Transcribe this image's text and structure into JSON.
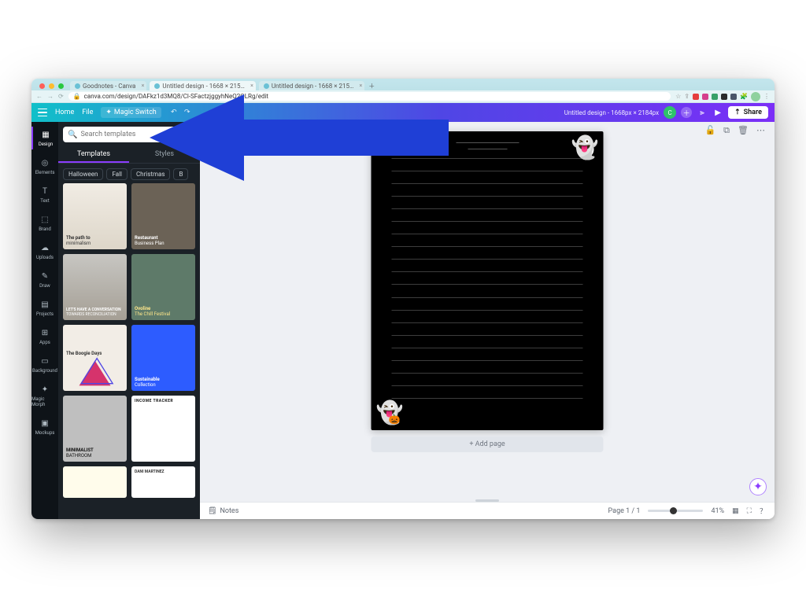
{
  "browser": {
    "tabs": [
      {
        "label": "Goodnotes - Canva",
        "active": false
      },
      {
        "label": "Untitled design - 1668 × 215…",
        "active": true
      },
      {
        "label": "Untitled design - 1668 × 215…",
        "active": false
      }
    ],
    "url": "canva.com/design/DAFkz1d3MQ8/Cl-SFactzjggyhNeQ2QLRg/edit"
  },
  "top": {
    "home": "Home",
    "file": "File",
    "magic": "Magic Switch",
    "doc_title": "Untitled design - 1668px × 2184px",
    "avatar_initial": "C",
    "share": "Share"
  },
  "rail": {
    "items": [
      {
        "label": "Design",
        "icon": "▦"
      },
      {
        "label": "Elements",
        "icon": "◎"
      },
      {
        "label": "Text",
        "icon": "T"
      },
      {
        "label": "Brand",
        "icon": "⬚"
      },
      {
        "label": "Uploads",
        "icon": "☁"
      },
      {
        "label": "Draw",
        "icon": "✎"
      },
      {
        "label": "Projects",
        "icon": "▤"
      },
      {
        "label": "Apps",
        "icon": "⊞"
      },
      {
        "label": "Background",
        "icon": "▭"
      },
      {
        "label": "Magic Morph",
        "icon": "✦"
      },
      {
        "label": "Mockups",
        "icon": "▣"
      }
    ]
  },
  "panel": {
    "search_placeholder": "Search templates",
    "tab_templates": "Templates",
    "tab_styles": "Styles",
    "chips": [
      "Halloween",
      "Fall",
      "Christmas",
      "B"
    ],
    "thumbs": [
      {
        "t1": "The path to",
        "t2": "minimalism"
      },
      {
        "t1": "Restaurant",
        "t2": "Business Plan"
      },
      {
        "t1": "LET'S HAVE A CONVERSATION",
        "t2": "TOWARDS RECONCILIATION"
      },
      {
        "t1": "Ovoline",
        "t2": "The Chill Festival"
      },
      {
        "t1": "The Boogie Days",
        "t2": ""
      },
      {
        "t1": "Sustainable",
        "t2": "Collection"
      },
      {
        "t1": "MINIMALIST",
        "t2": "BATHROOM"
      },
      {
        "t1": "INCOME TRACKER",
        "t2": ""
      },
      {
        "t1": "",
        "t2": ""
      },
      {
        "t1": "DANI MARTINEZ",
        "t2": ""
      }
    ]
  },
  "canvas": {
    "add_page": "+ Add page",
    "notes": "Notes",
    "page_indicator": "Page 1 / 1",
    "zoom_pct": "41%"
  }
}
